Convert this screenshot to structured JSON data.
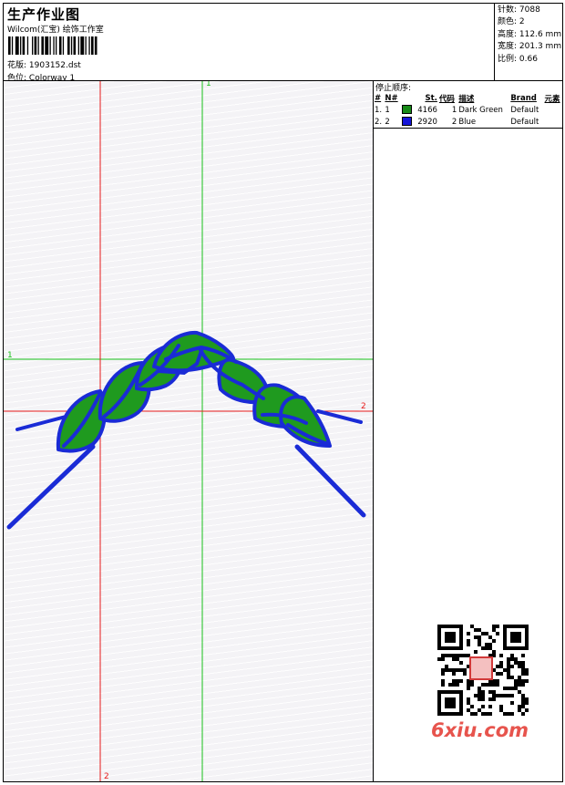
{
  "header": {
    "title": "生产作业图",
    "company": "Wilcom(汇宝) 绘饰工作室",
    "design_label": "花版:",
    "design_value": "1903152.dst",
    "colorway_label": "色位:",
    "colorway_value": "Colorway 1"
  },
  "stats": {
    "stitches_label": "针数:",
    "stitches_value": "7088",
    "colors_label": "颜色:",
    "colors_value": "2",
    "height_label": "高度:",
    "height_value": "112.6 mm",
    "width_label": "宽度:",
    "width_value": "201.3 mm",
    "scale_label": "比例:",
    "scale_value": "0.66"
  },
  "axes": {
    "green_top": "1",
    "green_left": "1",
    "red_right": "2",
    "red_bottom": "2"
  },
  "stop_sequence": {
    "title": "停止顺序:",
    "columns": [
      "#",
      "N#",
      "St.",
      "代码",
      "描述",
      "Brand",
      "元素"
    ],
    "rows": [
      {
        "num": "1.",
        "n": "1",
        "color": "#178a17",
        "stitches": "4166",
        "code": "1",
        "desc": "Dark Green",
        "brand": "Default",
        "element": ""
      },
      {
        "num": "2.",
        "n": "2",
        "color": "#1414d8",
        "stitches": "2920",
        "code": "2",
        "desc": "Blue",
        "brand": "Default",
        "element": ""
      }
    ]
  },
  "watermark": {
    "text": "6xiu.com",
    "stamp": "秀图"
  },
  "colors": {
    "leaf_fill": "#1f9a1f",
    "outline": "#1a2bd6",
    "green_axis": "#19c219",
    "red_axis": "#e61a1a"
  }
}
